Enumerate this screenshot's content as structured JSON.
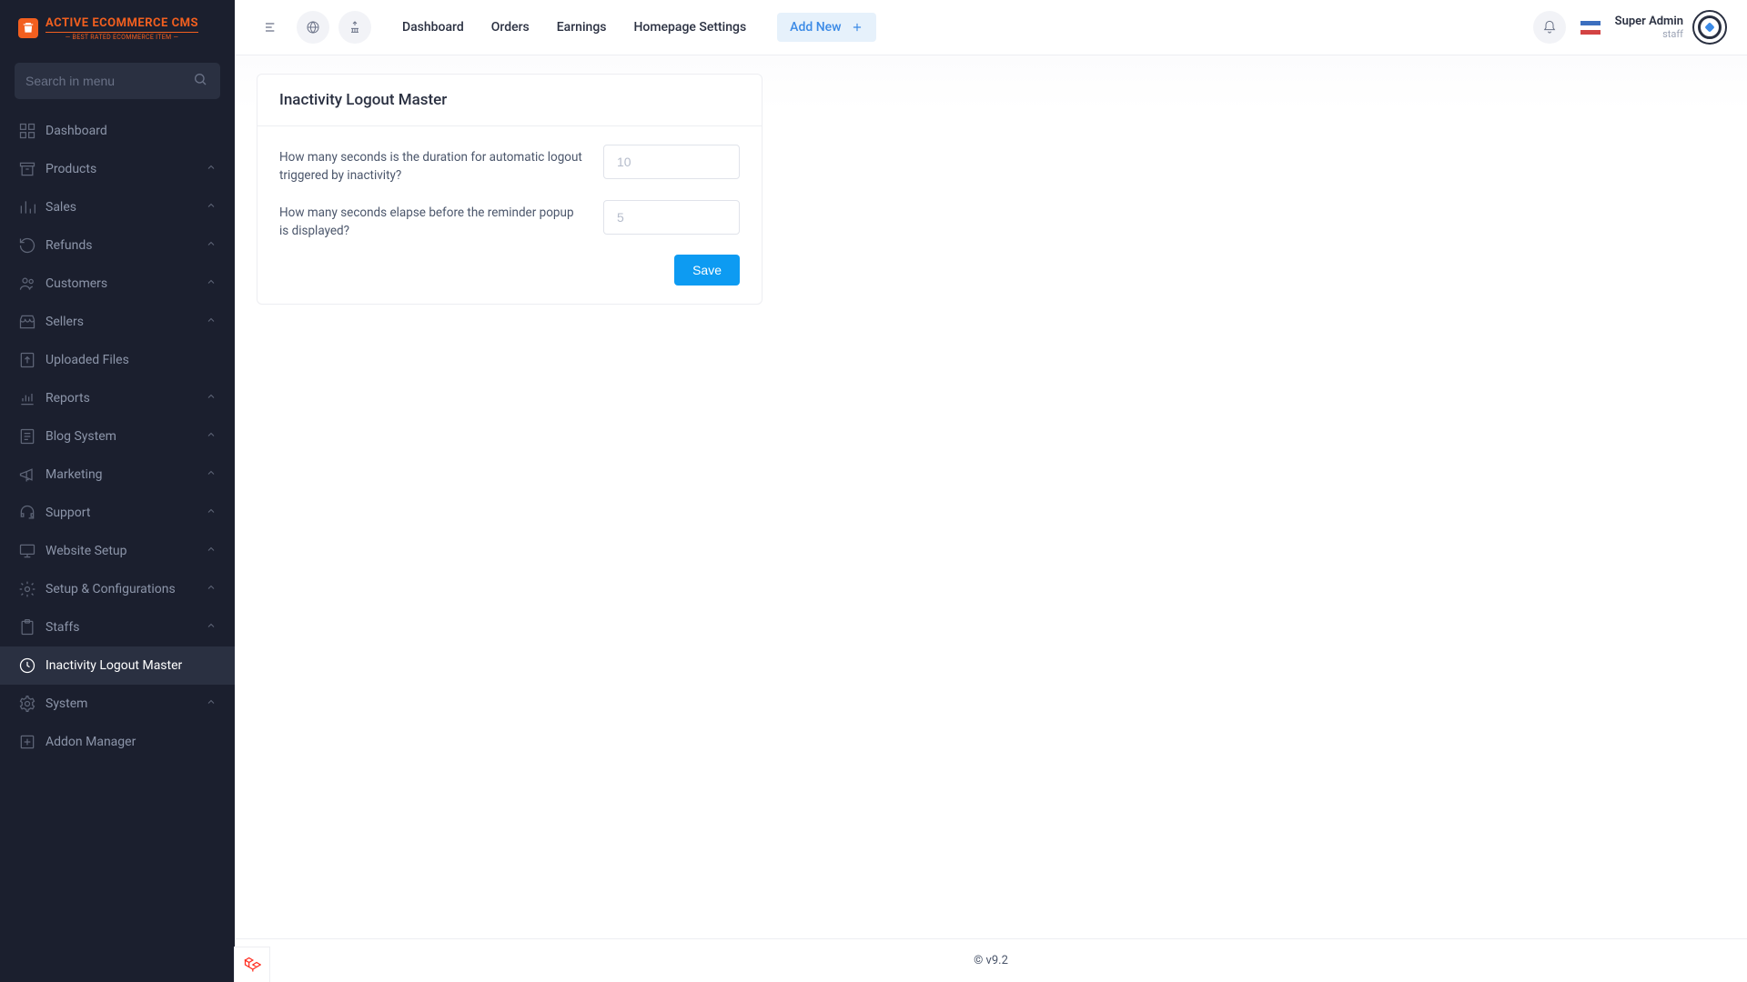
{
  "brand": {
    "name": "ACTIVE ECOMMERCE CMS",
    "tagline": "BEST RATED ECOMMERCE ITEM"
  },
  "search": {
    "placeholder": "Search in menu"
  },
  "sidebar": {
    "items": [
      {
        "label": "Dashboard",
        "hasSub": false
      },
      {
        "label": "Products",
        "hasSub": true
      },
      {
        "label": "Sales",
        "hasSub": true
      },
      {
        "label": "Refunds",
        "hasSub": true
      },
      {
        "label": "Customers",
        "hasSub": true
      },
      {
        "label": "Sellers",
        "hasSub": true
      },
      {
        "label": "Uploaded Files",
        "hasSub": false
      },
      {
        "label": "Reports",
        "hasSub": true
      },
      {
        "label": "Blog System",
        "hasSub": true
      },
      {
        "label": "Marketing",
        "hasSub": true
      },
      {
        "label": "Support",
        "hasSub": true
      },
      {
        "label": "Website Setup",
        "hasSub": true
      },
      {
        "label": "Setup & Configurations",
        "hasSub": true
      },
      {
        "label": "Staffs",
        "hasSub": true
      },
      {
        "label": "Inactivity Logout Master",
        "hasSub": false,
        "active": true
      },
      {
        "label": "System",
        "hasSub": true
      },
      {
        "label": "Addon Manager",
        "hasSub": false
      }
    ]
  },
  "topnav": {
    "links": [
      "Dashboard",
      "Orders",
      "Earnings",
      "Homepage Settings"
    ],
    "add_new": "Add New"
  },
  "user": {
    "name": "Super Admin",
    "role": "staff"
  },
  "card": {
    "title": "Inactivity Logout Master",
    "field1_label": "How many seconds is the duration for automatic logout triggered by inactivity?",
    "field1_placeholder": "10",
    "field2_label": "How many seconds elapse before the reminder popup is displayed?",
    "field2_placeholder": "5",
    "save": "Save"
  },
  "footer": {
    "version": "© v9.2"
  }
}
